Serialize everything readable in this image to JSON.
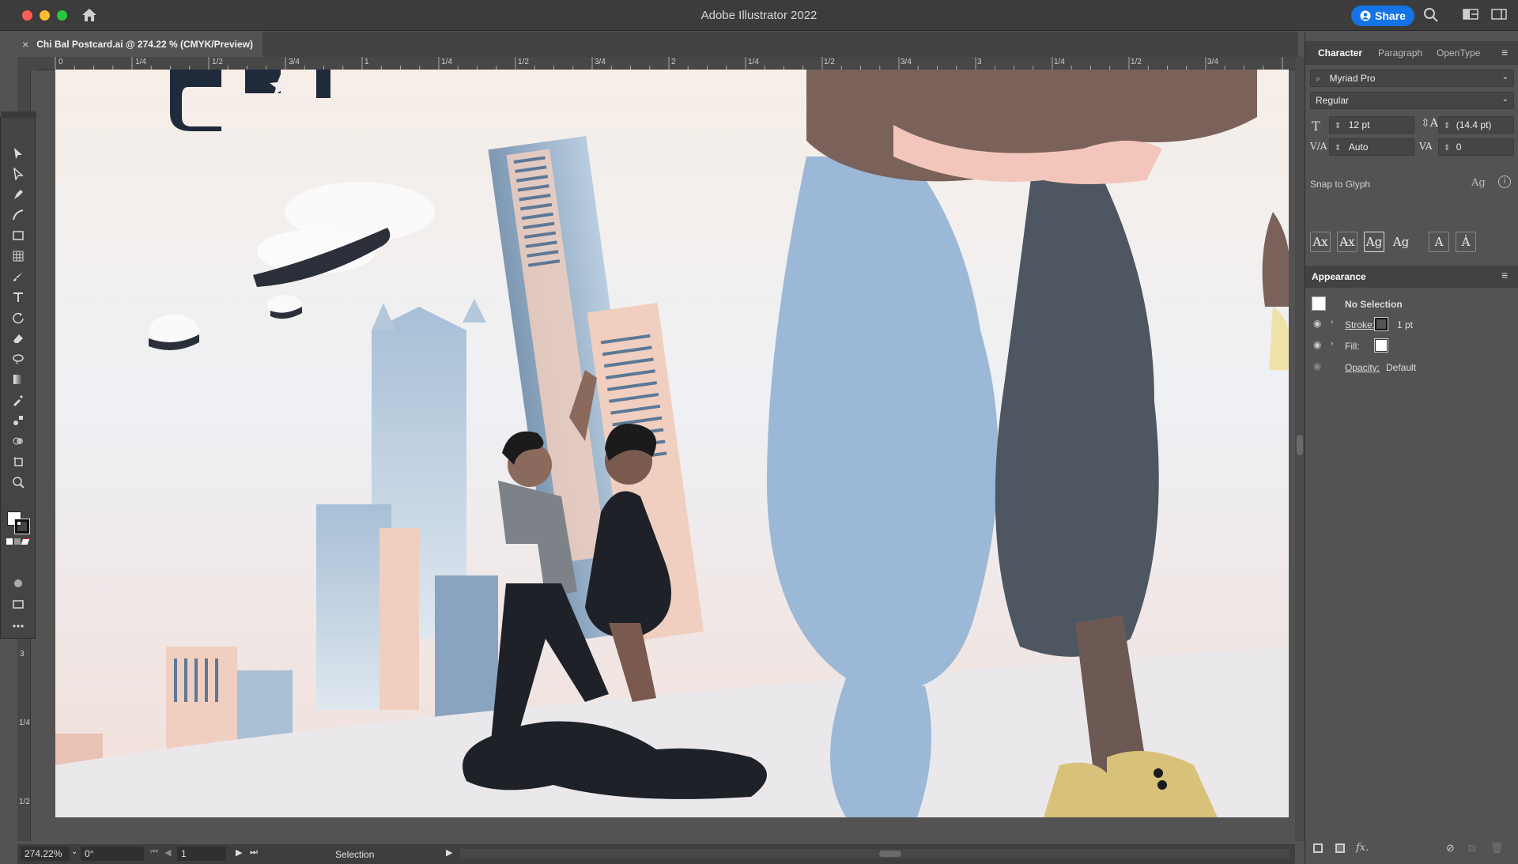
{
  "app": {
    "title": "Adobe Illustrator 2022",
    "share_label": "Share",
    "colors": {
      "accent": "#1473e6",
      "traffic_red": "#ff5f57",
      "traffic_yellow": "#febc2e",
      "traffic_green": "#28c840"
    }
  },
  "document": {
    "tab_label": "Chi Bal Postcard.ai @ 274.22 % (CMYK/Preview)",
    "close_glyph": "×"
  },
  "ruler_h": [
    "0",
    "1/4",
    "1/2",
    "3/4",
    "1",
    "1/4",
    "1/2",
    "3/4",
    "2",
    "1/4",
    "1/2",
    "3/4",
    "3",
    "1/4",
    "1/2",
    "3/4"
  ],
  "ruler_v": [
    "3",
    "1/4",
    "1/2"
  ],
  "status": {
    "zoom": "274.22%",
    "rotation": "0°",
    "artboard": "1",
    "tool_label": "Selection"
  },
  "tools": [
    "selection-icon",
    "direct-selection-icon",
    "pen-icon",
    "curvature-icon",
    "rectangle-icon",
    "grid-icon",
    "paintbrush-icon",
    "type-icon",
    "rotate-icon",
    "eraser-icon",
    "lasso-icon",
    "gradient-icon",
    "eyedropper-icon",
    "blend-icon",
    "shape-builder-icon",
    "artboard-icon",
    "zoom-icon"
  ],
  "character_panel": {
    "tabs": [
      "Character",
      "Paragraph",
      "OpenType"
    ],
    "font_family": "Myriad Pro",
    "font_style": "Regular",
    "font_size": "12 pt",
    "leading": "(14.4 pt)",
    "kerning": "Auto",
    "tracking": "0",
    "snap_label": "Snap to Glyph"
  },
  "appearance_panel": {
    "title": "Appearance",
    "no_selection": "No Selection",
    "stroke_label": "Stroke:",
    "stroke_value": "1 pt",
    "fill_label": "Fill:",
    "opacity_label": "Opacity:",
    "opacity_value": "Default"
  }
}
